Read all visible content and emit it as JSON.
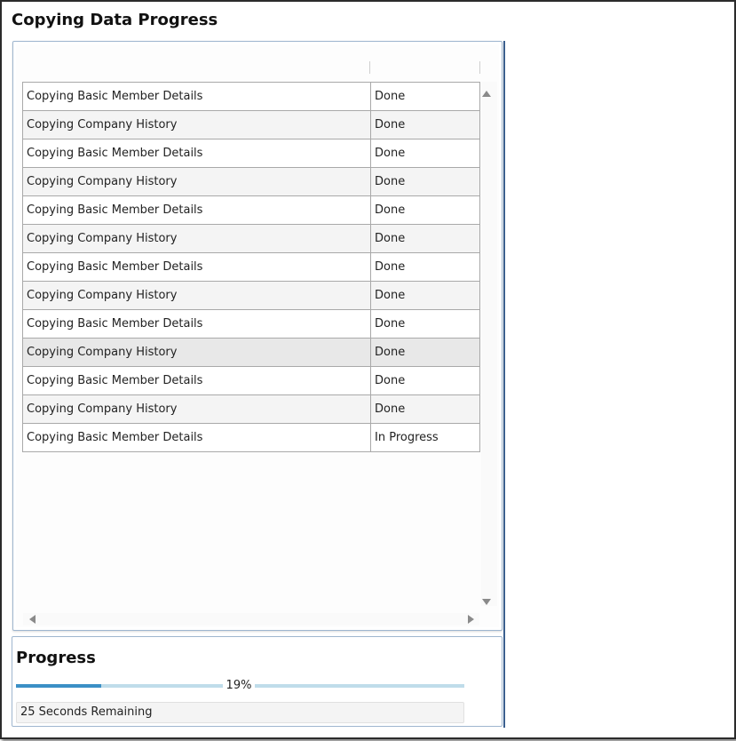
{
  "dialog": {
    "title": "Copying Data Progress"
  },
  "table": {
    "rows": [
      {
        "task": "Copying Basic Member Details",
        "status": "Done"
      },
      {
        "task": "Copying Company History",
        "status": "Done"
      },
      {
        "task": "Copying Basic Member Details",
        "status": "Done"
      },
      {
        "task": "Copying Company History",
        "status": "Done"
      },
      {
        "task": "Copying Basic Member Details",
        "status": "Done"
      },
      {
        "task": "Copying Company History",
        "status": "Done"
      },
      {
        "task": "Copying Basic Member Details",
        "status": "Done"
      },
      {
        "task": "Copying Company History",
        "status": "Done"
      },
      {
        "task": "Copying Basic Member Details",
        "status": "Done"
      },
      {
        "task": "Copying Company History",
        "status": "Done"
      },
      {
        "task": "Copying Basic Member Details",
        "status": "Done"
      },
      {
        "task": "Copying Company History",
        "status": "Done"
      },
      {
        "task": "Copying Basic Member Details",
        "status": "In Progress"
      }
    ]
  },
  "progress": {
    "title": "Progress",
    "percent": 19,
    "percent_label": "19%",
    "remaining": "25 Seconds Remaining"
  },
  "colors": {
    "bar_fill": "#3b8fc6",
    "bar_track": "#bfdcea",
    "panel_border": "#9fb6cf"
  },
  "icons": [
    "scroll-up-arrow-icon",
    "scroll-down-arrow-icon",
    "scroll-left-arrow-icon",
    "scroll-right-arrow-icon"
  ]
}
